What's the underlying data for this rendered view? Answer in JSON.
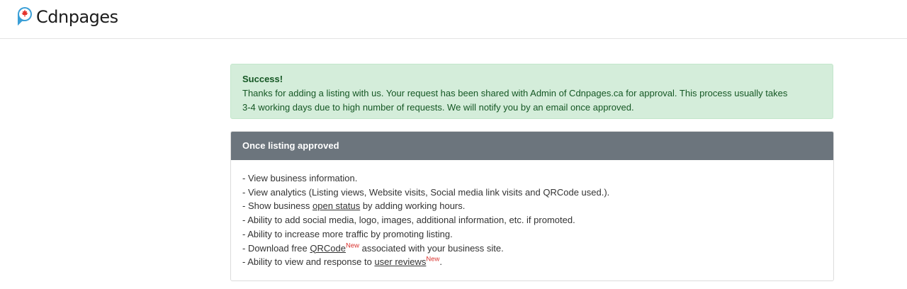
{
  "header": {
    "logo_text": "Cdnpages",
    "colors": {
      "logo_blue": "#3b9fd7",
      "logo_red": "#e4322b"
    }
  },
  "alert": {
    "title": "Success!",
    "message": "Thanks for adding a listing with us. Your request has been shared with Admin of Cdnpages.ca for approval. This process usually takes 3-4 working days due to high number of requests. We will notify you by an email once approved.",
    "colors": {
      "background": "#d4edda",
      "text": "#155724"
    }
  },
  "card": {
    "header": "Once listing approved",
    "header_color": "#6c757d",
    "items": {
      "item1": "- View business information.",
      "item2": "- View analytics (Listing views, Website visits, Social media link visits and QRCode used.).",
      "item3": {
        "pre": "- Show business ",
        "link": "open status",
        "post": " by adding working hours."
      },
      "item4": "- Ability to add social media, logo, images, additional information, etc. if promoted.",
      "item5": "- Ability to increase more traffic by promoting listing.",
      "item6": {
        "pre": "- Download free ",
        "link": "QRCode",
        "badge": "New",
        "post": " associated with your business site."
      },
      "item7": {
        "pre": "- Ability to view and response to ",
        "link": "user reviews",
        "badge": "New",
        "post": "."
      }
    },
    "badge_color": "#d9322e"
  }
}
